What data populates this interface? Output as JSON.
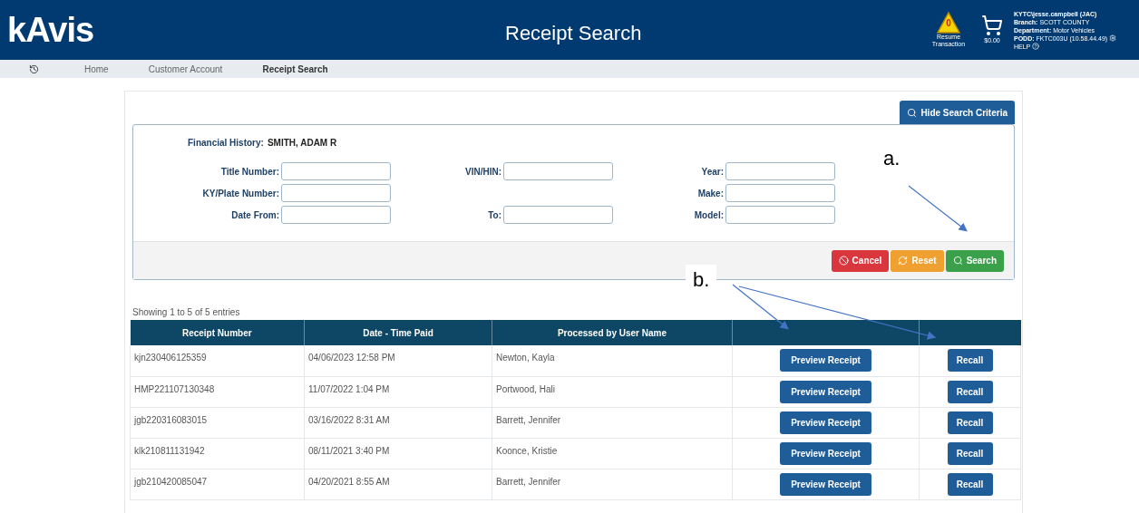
{
  "header": {
    "logo": "kAvis",
    "title": "Receipt Search",
    "resume": {
      "count": "0",
      "label": "Resume Transaction"
    },
    "cart": {
      "amount": "$0.00"
    },
    "user": {
      "login": "KYTC\\jesse.campbell (JAC)",
      "lines": [
        {
          "label": "Branch:",
          "value": "SCOTT COUNTY"
        },
        {
          "label": "Department:",
          "value": "Motor Vehicles"
        },
        {
          "label": "PODD:",
          "value": "FKTC003U (10.58.44.49)"
        }
      ],
      "help": "HELP"
    }
  },
  "breadcrumb": [
    {
      "label": "Home",
      "selected": false
    },
    {
      "label": "Customer Account",
      "selected": false
    },
    {
      "label": "Receipt Search",
      "selected": true
    }
  ],
  "hide_button": "Hide Search Criteria",
  "financial_history": {
    "label": "Financial History:",
    "value": "SMITH, ADAM R"
  },
  "fields": [
    [
      {
        "kind": "field",
        "label": "Title Number:"
      },
      {
        "kind": "field",
        "label": "VIN/HIN:"
      },
      {
        "kind": "field",
        "label": "Year:"
      }
    ],
    [
      {
        "kind": "field",
        "label": "KY/Plate Number:"
      },
      {
        "kind": "spacer"
      },
      {
        "kind": "field",
        "label": "Make:"
      }
    ],
    [
      {
        "kind": "field",
        "label": "Date From:"
      },
      {
        "kind": "field",
        "label": "To:"
      },
      {
        "kind": "field",
        "label": "Model:"
      }
    ]
  ],
  "actions": [
    {
      "kind": "cancel",
      "label": "Cancel"
    },
    {
      "kind": "reset",
      "label": "Reset"
    },
    {
      "kind": "search",
      "label": "Search"
    }
  ],
  "entries_info": "Showing 1 to 5 of 5 entries",
  "table": {
    "columns": [
      "Receipt Number",
      "Date - Time Paid",
      "Processed by User Name"
    ],
    "rows": [
      {
        "cells": [
          "kjn230406125359",
          "04/06/2023 12:58 PM",
          "Newton, Kayla"
        ],
        "preview": "Preview Receipt",
        "recall": "Recall"
      },
      {
        "cells": [
          "HMP221107130348",
          "11/07/2022 1:04 PM",
          "Portwood, Hali"
        ],
        "preview": "Preview Receipt",
        "recall": "Recall"
      },
      {
        "cells": [
          "jgb220316083015",
          "03/16/2022 8:31 AM",
          "Barrett, Jennifer"
        ],
        "preview": "Preview Receipt",
        "recall": "Recall"
      },
      {
        "cells": [
          "klk210811131942",
          "08/11/2021 3:40 PM",
          "Koonce, Kristie"
        ],
        "preview": "Preview Receipt",
        "recall": "Recall"
      },
      {
        "cells": [
          "jgb210420085047",
          "04/20/2021 8:55 AM",
          "Barrett, Jennifer"
        ],
        "preview": "Preview Receipt",
        "recall": "Recall"
      }
    ]
  },
  "annotations": [
    "a.",
    "b."
  ]
}
